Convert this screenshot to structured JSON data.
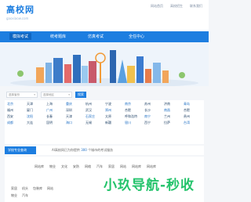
{
  "header": {
    "logo_cn": "高校网",
    "logo_url": "gaoxiaow.com",
    "links": [
      "网站首页",
      "高校招生",
      "联系我们"
    ]
  },
  "nav": {
    "items": [
      {
        "label": "模拟考试",
        "active": true
      },
      {
        "label": "统考题库",
        "active": false
      },
      {
        "label": "仿真考试",
        "active": false
      },
      {
        "label": "全任中心",
        "active": false
      }
    ]
  },
  "search": {
    "province_placeholder": "选择省份",
    "city_placeholder": "选择地区",
    "button_label": "搜索"
  },
  "cities": [
    "北京",
    "天津",
    "上海",
    "重庆",
    "杭州",
    "宁波",
    "南京",
    "苏州",
    "济南",
    "青岛",
    "福州",
    "厦门",
    "广州",
    "深圳",
    "武汉",
    "郑州",
    "合肥",
    "长沙",
    "南昌",
    "合肥",
    "西安",
    "沈阳",
    "长春",
    "天津",
    "石家庄",
    "太原",
    "呼和浩特",
    "南宁",
    "兰州",
    "贵州",
    "成都",
    "大连",
    "昆明",
    "海口",
    "无锡",
    "新疆",
    "银川",
    "西宁",
    "拉萨",
    "台湾"
  ],
  "notice": {
    "tag": "学校专业查询",
    "text_prefix": "AI高校网已为你提供",
    "count": "300",
    "text_suffix": "个城市的考试服务"
  },
  "categories": {
    "row1": [
      "网站库",
      "物业",
      "文化",
      "安防",
      "网络",
      "汽车",
      "家居",
      "网站",
      "网站库",
      "网站库"
    ],
    "row2": [
      "家居",
      "机头",
      "包装库",
      "网站"
    ],
    "row3": [
      "物业",
      "汽车"
    ]
  },
  "watermark": "小玖导航-秒收",
  "colors": {
    "brand_blue": "#1d7ee0",
    "watermark_green": "#23c36b"
  }
}
